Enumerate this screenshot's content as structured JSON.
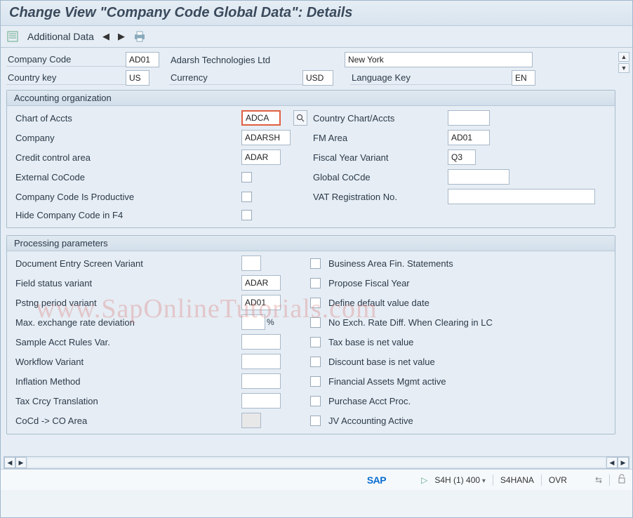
{
  "title": "Change View \"Company Code Global Data\": Details",
  "toolbar": {
    "additional_data": "Additional Data"
  },
  "header": {
    "company_code_label": "Company Code",
    "company_code_value": "AD01",
    "company_name": "Adarsh Technologies Ltd",
    "city": "New York",
    "country_key_label": "Country key",
    "country_key_value": "US",
    "currency_label": "Currency",
    "currency_value": "USD",
    "language_key_label": "Language Key",
    "language_key_value": "EN"
  },
  "accounting": {
    "group_title": "Accounting organization",
    "chart_of_accts_label": "Chart of Accts",
    "chart_of_accts_value": "ADCA",
    "country_chart_label": "Country Chart/Accts",
    "country_chart_value": "",
    "company_label": "Company",
    "company_value": "ADARSH",
    "fm_area_label": "FM Area",
    "fm_area_value": "AD01",
    "credit_control_label": "Credit control area",
    "credit_control_value": "ADAR",
    "fiscal_year_label": "Fiscal Year Variant",
    "fiscal_year_value": "Q3",
    "external_cocode_label": "External CoCode",
    "global_cocde_label": "Global CoCde",
    "global_cocde_value": "",
    "productive_label": "Company Code Is Productive",
    "vat_label": "VAT Registration No.",
    "vat_value": "",
    "hide_f4_label": "Hide Company Code in F4"
  },
  "processing": {
    "group_title": "Processing parameters",
    "doc_entry_label": "Document Entry Screen Variant",
    "doc_entry_value": "",
    "ba_fin_label": "Business Area Fin. Statements",
    "field_status_label": "Field status variant",
    "field_status_value": "ADAR",
    "propose_fy_label": "Propose Fiscal Year",
    "posting_period_label": "Pstng period variant",
    "posting_period_value": "AD01",
    "define_default_label": "Define default value date",
    "max_rate_label": "Max. exchange rate deviation",
    "max_rate_value": "",
    "percent": "%",
    "no_exch_label": "No Exch. Rate Diff. When Clearing in LC",
    "sample_rules_label": "Sample Acct Rules Var.",
    "sample_rules_value": "",
    "tax_base_label": "Tax base is net value",
    "workflow_label": "Workflow Variant",
    "workflow_value": "",
    "discount_base_label": "Discount base is net value",
    "inflation_label": "Inflation Method",
    "inflation_value": "",
    "fin_assets_label": "Financial Assets Mgmt active",
    "tax_crcy_label": "Tax Crcy Translation",
    "tax_crcy_value": "",
    "purchase_acct_label": "Purchase Acct Proc.",
    "cocd_co_label": "CoCd -> CO Area",
    "jv_acct_label": "JV Accounting Active"
  },
  "status": {
    "sap": "SAP",
    "system": "S4H (1) 400",
    "server": "S4HANA",
    "mode": "OVR"
  },
  "watermark": "www.SapOnlineTutorials.com"
}
